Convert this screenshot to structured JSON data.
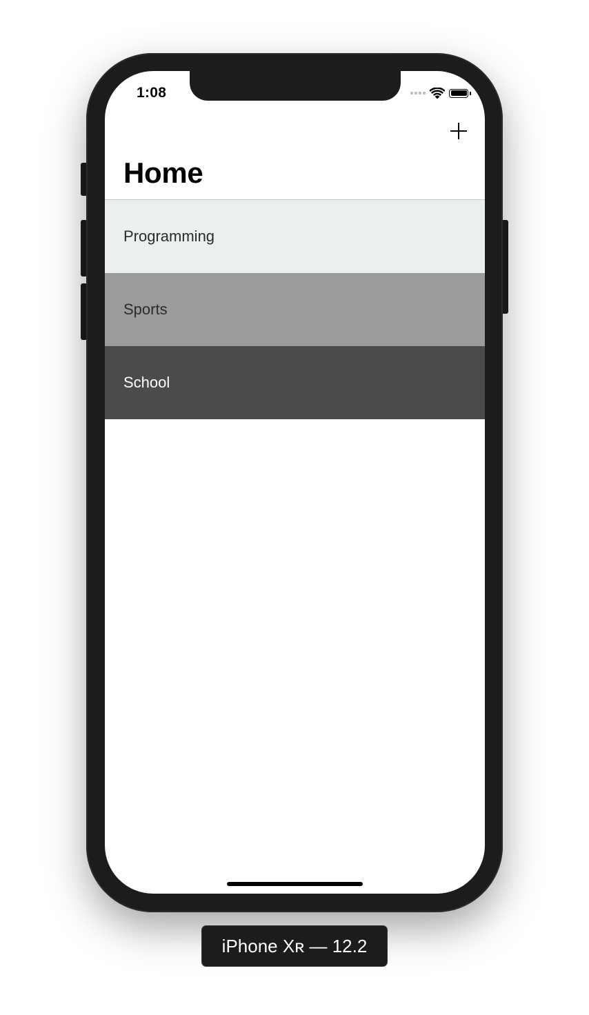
{
  "status_bar": {
    "time": "1:08"
  },
  "nav": {
    "title": "Home",
    "add_icon": "plus-icon"
  },
  "list": {
    "items": [
      {
        "label": "Programming",
        "background": "#ebeff0",
        "text_color": "#2b2b2b"
      },
      {
        "label": "Sports",
        "background": "#9a9c9b",
        "text_color": "#2b2b2b"
      },
      {
        "label": "School",
        "background": "#4a4b4b",
        "text_color": "#ffffff"
      }
    ]
  },
  "simulator": {
    "device_label": "iPhone Xʀ — 12.2"
  },
  "colors": {
    "device_frame": "#1c1c1c",
    "screen_background": "#ffffff"
  }
}
